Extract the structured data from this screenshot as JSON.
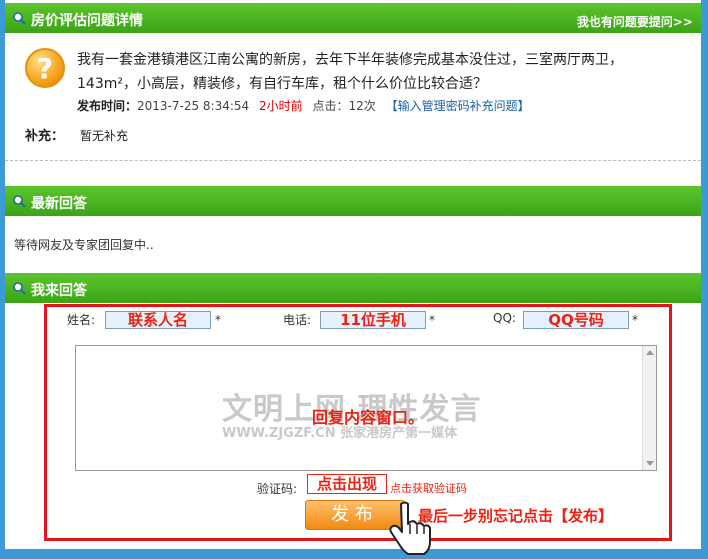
{
  "header_detail": {
    "title": "房价评估问题详情",
    "right_link": "我也有问题要提问>>"
  },
  "question": {
    "text": "我有一套金港镇港区江南公寓的新房，去年下半年装修完成基本没住过，三室两厅两卫，143m²，小高层，精装修，有自行车库，租个什么价位比较合适？",
    "meta_label": "发布时间：",
    "meta_time": "2013-7-25 8:34:54",
    "meta_ago": "2小时前",
    "meta_clicks": "点击：12次",
    "meta_link": "【输入管理密码补充问题】",
    "supplement_label": "补充：",
    "supplement_text": "暂无补充"
  },
  "header_latest": {
    "title": "最新回答"
  },
  "latest": {
    "waiting": "等待网友及专家团回复中.."
  },
  "header_reply": {
    "title": "我来回答"
  },
  "form": {
    "name_label": "姓名:",
    "name_value": "联系人名",
    "phone_label": "电话:",
    "phone_value": "11位手机",
    "qq_label": "QQ:",
    "qq_value": "QQ号码",
    "star": "*",
    "watermark_main": "文明上网 理性发言",
    "watermark_sub": "WWW.ZJGZF.CN 张家港房产第一媒体",
    "area_note": "回复内容窗口。",
    "verify_label": "验证码:",
    "verify_value": "点击出现",
    "verify_link": "点击获取验证码",
    "submit": "发布",
    "final_note": "最后一步别忘记点击【发布】"
  },
  "colors": {
    "bar_green": "#3aa416",
    "frame_blue": "#3d9ad6",
    "annotation_red": "#e21"
  }
}
